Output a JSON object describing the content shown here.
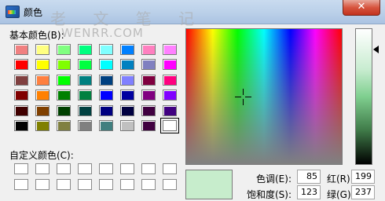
{
  "window": {
    "title": "颜色",
    "close_glyph": "✕"
  },
  "watermark": {
    "text": "老 文 笔 记",
    "url": "WENRR.COM"
  },
  "basic_colors": {
    "label": "基本颜色(B):",
    "swatches": [
      [
        "#f08080",
        "#ffff80",
        "#80ff80",
        "#00ff80",
        "#80ffff",
        "#0080ff",
        "#ff80c0",
        "#ff80ff"
      ],
      [
        "#ff0000",
        "#ffff00",
        "#80ff00",
        "#00ff40",
        "#00ffff",
        "#0080c0",
        "#8080c0",
        "#ff00ff"
      ],
      [
        "#804040",
        "#ff8040",
        "#00ff00",
        "#008080",
        "#004080",
        "#8080ff",
        "#800040",
        "#ff0080"
      ],
      [
        "#800000",
        "#ff8000",
        "#008000",
        "#008040",
        "#0000ff",
        "#0000a0",
        "#800080",
        "#8000ff"
      ],
      [
        "#400000",
        "#804000",
        "#004000",
        "#004040",
        "#000080",
        "#000040",
        "#400040",
        "#400080"
      ],
      [
        "#000000",
        "#808000",
        "#808040",
        "#808080",
        "#408080",
        "#c0c0c0",
        "#400040",
        "#ffffff"
      ]
    ],
    "selected": [
      5,
      7
    ]
  },
  "custom_colors": {
    "label": "自定义颜色(C):",
    "swatches": [
      [
        "#ffffff",
        "#ffffff",
        "#ffffff",
        "#ffffff",
        "#ffffff",
        "#ffffff",
        "#ffffff",
        "#ffffff"
      ],
      [
        "#ffffff",
        "#ffffff",
        "#ffffff",
        "#ffffff",
        "#ffffff",
        "#ffffff",
        "#ffffff",
        "#ffffff"
      ]
    ]
  },
  "preview": {
    "color": "#c7edcc"
  },
  "fields": {
    "hue": {
      "label": "色调(E):",
      "value": "85"
    },
    "saturation": {
      "label": "饱和度(S):",
      "value": "123"
    },
    "red": {
      "label": "红(R):",
      "value": "199"
    },
    "green": {
      "label": "绿(G):",
      "value": "237"
    }
  }
}
